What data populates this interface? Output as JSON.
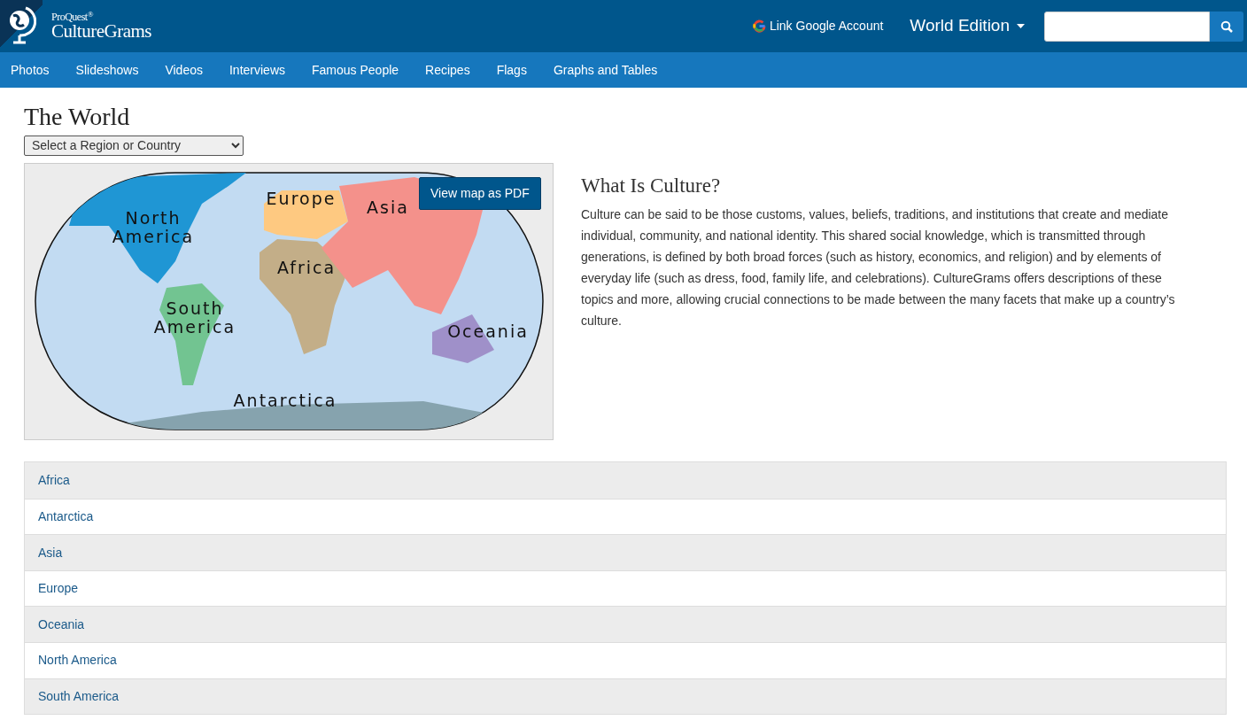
{
  "brand": {
    "publisher": "ProQuest$^{®}$",
    "product": "CultureGrams"
  },
  "header": {
    "google_link": "Link Google Account",
    "edition": "World Edition"
  },
  "nav": [
    "Photos",
    "Slideshows",
    "Videos",
    "Interviews",
    "Famous People",
    "Recipes",
    "Flags",
    "Graphs and Tables"
  ],
  "page_title": "The World",
  "region_select": {
    "value": "Select a Region or Country"
  },
  "map": {
    "pdf_button": "View map as PDF",
    "regions": [
      {
        "name": "North America",
        "color": "#1f96d4"
      },
      {
        "name": "South America",
        "color": "#72c491"
      },
      {
        "name": "Europe",
        "color": "#fec981"
      },
      {
        "name": "Africa",
        "color": "#c3ae88"
      },
      {
        "name": "Asia",
        "color": "#f4918b"
      },
      {
        "name": "Oceania",
        "color": "#9f90c9"
      },
      {
        "name": "Antarctica",
        "color": "#86a3ae"
      }
    ]
  },
  "about": {
    "title": "What Is Culture?",
    "text": "Culture can be said to be those customs, values, beliefs, traditions, and institutions that create and mediate individual, community, and national identity. This shared social knowledge, which is transmitted through generations, is defined by both broad forces (such as history, economics, and religion) and by elements of everyday life (such as dress, food, family life, and celebrations). CultureGrams offers descriptions of these topics and more, allowing crucial connections to be made between the many facets that make up a country’s culture."
  },
  "region_list": [
    "Africa",
    "Antarctica",
    "Asia",
    "Europe",
    "Oceania",
    "North America",
    "South America"
  ]
}
